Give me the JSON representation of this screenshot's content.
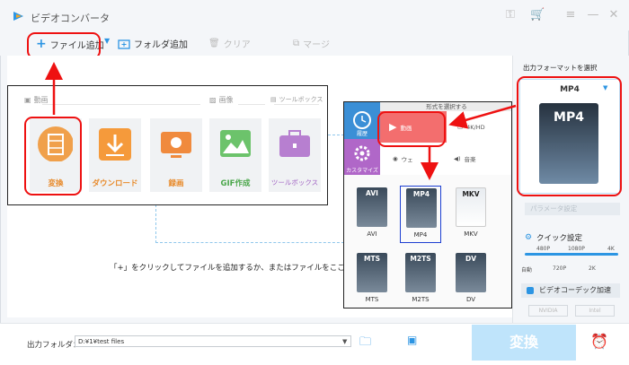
{
  "app": {
    "title": "ビデオコンバータ"
  },
  "toolbar": {
    "add_file": "ファイル追加",
    "add_folder": "フォルダ追加",
    "clear": "クリア",
    "merge": "マージ"
  },
  "tool_panel": {
    "tabs": [
      "動画",
      "画像",
      "ツールボックス"
    ],
    "tiles": [
      {
        "label": "変換",
        "color": "#f0a04b"
      },
      {
        "label": "ダウンロード",
        "color": "#f59a3b"
      },
      {
        "label": "録画",
        "color": "#f08a3d"
      },
      {
        "label": "GIF作成",
        "color": "#6cc36b"
      },
      {
        "label": "ツールボックス",
        "color": "#b77fd0"
      }
    ]
  },
  "hint": "「+」をクリックしてファイルを追加するか、またはファイルをここまで",
  "format_popup": {
    "header": "形式を選択する",
    "categories": [
      {
        "label": "履歴"
      },
      {
        "label": "カスタマイズ"
      }
    ],
    "tabs": [
      {
        "label": "動画"
      },
      {
        "label": "4K/HD"
      },
      {
        "label": "ウェ"
      },
      {
        "label": "音楽"
      }
    ],
    "formats": [
      "AVI",
      "MP4",
      "MKV",
      "MTS",
      "M2TS",
      "DV"
    ]
  },
  "right": {
    "title": "出力フォーマットを選択",
    "format": "MP4",
    "param_button": "パラメータ設定",
    "quick_label": "クイック設定",
    "res_labels": [
      "480P",
      "1080P",
      "4K"
    ],
    "res_labels_bottom": [
      "自動",
      "720P",
      "2K"
    ],
    "gpu": "ビデオコーデック加速",
    "chips": [
      "NVIDIA",
      "Intel"
    ]
  },
  "bottom": {
    "out_label": "出力フォルダ：",
    "out_path": "D:¥1¥test files",
    "convert": "変換"
  },
  "colors": {
    "accent": "#2c95e3",
    "highlight": "#e11111",
    "convert_bg": "#bfe4fb"
  }
}
